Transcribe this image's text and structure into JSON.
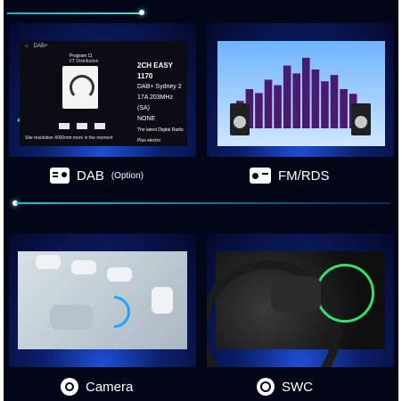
{
  "tiles": {
    "dab": {
      "caption": "DAB",
      "caption_note": "(Option)",
      "screen": {
        "status_left": "DAB+",
        "program_line1": "Program 11",
        "program_line2": "FT Distribution",
        "headline": "2CH EASY 1170",
        "line1": "DAB+ Sydney 2",
        "line2": "17A 203MHz (SA)",
        "line3": "NONE",
        "line4": "The latest Digital Radio Plus electro",
        "footer": "Site resolution 4000mm more in the moment"
      }
    },
    "fm": {
      "caption": "FM/RDS"
    },
    "camera": {
      "caption": "Camera"
    },
    "swc": {
      "caption": "SWC"
    }
  },
  "colors": {
    "accent": "#2ad3e0",
    "background": "#030616",
    "text": "#ffffff"
  },
  "eq_heights": [
    0.35,
    0.5,
    0.45,
    0.62,
    0.55,
    0.8,
    0.7,
    0.9,
    0.75,
    0.6,
    0.68,
    0.5,
    0.44,
    0.3
  ]
}
